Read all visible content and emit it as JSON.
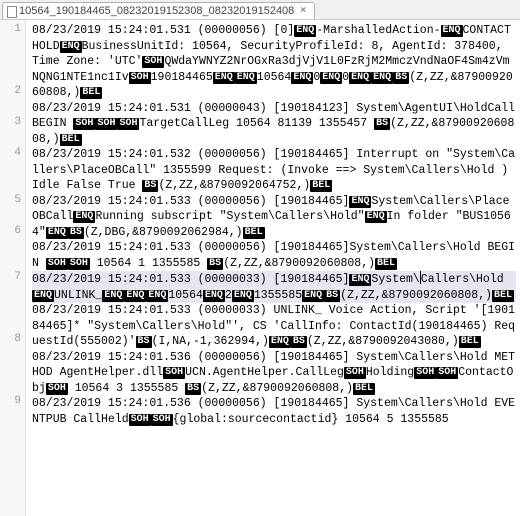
{
  "tab": {
    "title": "10564_190184465_08232019152308_08232019152408",
    "close": "×"
  },
  "gutter": [
    "1",
    "",
    "",
    "",
    "2",
    "",
    "3",
    "",
    "4",
    "",
    "",
    "5",
    "",
    "6",
    "",
    "",
    "7",
    "",
    "",
    "",
    "8",
    "",
    "",
    "",
    "9",
    ""
  ],
  "tokens": {
    "ENQ": "ENQ",
    "SOH": "SOH",
    "BS": "BS",
    "BEL": "BEL"
  },
  "lines": [
    {
      "row": 1,
      "highlight": false,
      "segments": [
        [
          [
            "t",
            "08/23/2019 15:24:01.531 (00000056)"
          ]
        ],
        [
          [
            "t",
            "[0]"
          ],
          [
            "k",
            "ENQ"
          ],
          [
            "t",
            "-MarshalledAction-"
          ],
          [
            "k",
            "ENQ"
          ],
          [
            "t",
            "CONTACTHOLD"
          ],
          [
            "k",
            "ENQ"
          ],
          [
            "t",
            "BusinessUnitId: 10564, SecurityProfileId: 8, AgentId: 378400, Time Zone: 'UTC'"
          ],
          [
            "k",
            "SOH"
          ],
          [
            "t",
            "QWdaYWNYZ2NrOGxRa3djVjV1L0FzRjM2MmczVndNaOF4Sm4zVmNQNG1NTE1nc1Iv"
          ],
          [
            "k",
            "SOH"
          ],
          [
            "t",
            "190184465"
          ],
          [
            "k",
            "ENQ"
          ],
          [
            "k",
            "ENQ"
          ],
          [
            "t",
            "10564"
          ],
          [
            "k",
            "ENQ"
          ],
          [
            "t",
            "0"
          ],
          [
            "k",
            "ENQ"
          ],
          [
            "t",
            "0"
          ],
          [
            "k",
            "ENQ"
          ],
          [
            "k",
            "ENQ"
          ],
          [
            "k",
            "BS"
          ],
          [
            "t",
            "(Z,ZZ,&8790092060808,)"
          ],
          [
            "k",
            "BEL"
          ]
        ]
      ]
    },
    {
      "row": 2,
      "highlight": false,
      "segments": [
        [
          [
            "t",
            "08/23/2019 15:24:01.531 (00000043) [190184123] System\\AgentUI\\HoldCall BEGIN "
          ],
          [
            "k",
            "SOH"
          ],
          [
            "k",
            "SOH"
          ],
          [
            "k",
            "SOH"
          ],
          [
            "t",
            "TargetCallLeg 10564 81139 1355457  "
          ],
          [
            "k",
            "BS"
          ],
          [
            "t",
            "(Z,ZZ,&8790092060808,)"
          ],
          [
            "k",
            "BEL"
          ]
        ]
      ]
    },
    {
      "row": 3,
      "highlight": false,
      "segments": [
        [
          [
            "t",
            "08/23/2019 15:24:01.532 (00000056) [190184465] Interrupt on \"System\\Callers\\PlaceOBCall\" 1355599 Request: (Invoke ==> System\\Callers\\Hold  ) Idle False True "
          ],
          [
            "k",
            "BS"
          ],
          [
            "t",
            "(Z,ZZ,&8790092064752,)"
          ],
          [
            "k",
            "BEL"
          ]
        ]
      ]
    },
    {
      "row": 4,
      "highlight": false,
      "segments": [
        [
          [
            "t",
            "08/23/2019 15:24:01.533 (00000056)"
          ]
        ],
        [
          [
            "t",
            "[190184465]"
          ],
          [
            "k",
            "ENQ"
          ],
          [
            "t",
            "System\\Callers\\PlaceOBCall"
          ],
          [
            "k",
            "ENQ"
          ],
          [
            "t",
            "Running subscript \"System\\Callers\\Hold\""
          ],
          [
            "k",
            "ENQ"
          ],
          [
            "t",
            "In folder \"BUS10564\""
          ],
          [
            "k",
            "ENQ"
          ],
          [
            "k",
            "BS"
          ],
          [
            "t",
            "(Z,DBG,&8790092062984,)"
          ],
          [
            "k",
            "BEL"
          ]
        ]
      ]
    },
    {
      "row": 5,
      "highlight": false,
      "segments": [
        [
          [
            "t",
            "08/23/2019 15:24:01.533 (00000056) [190184465]System\\Callers\\Hold BEGIN "
          ],
          [
            "k",
            "SOH"
          ],
          [
            "k",
            "SOH"
          ],
          [
            "t",
            " 10564 1 1355585  "
          ],
          [
            "k",
            "BS"
          ],
          [
            "t",
            "(Z,ZZ,&8790092060808,)"
          ],
          [
            "k",
            "BEL"
          ]
        ]
      ]
    },
    {
      "row": 6,
      "highlight": true,
      "segments": [
        [
          [
            "t",
            "08/23/2019 15:24:01.533 (00000033)"
          ]
        ],
        [
          [
            "t",
            "[190184465]"
          ],
          [
            "k",
            "ENQ"
          ],
          [
            "t",
            "System\\"
          ],
          [
            "c",
            ""
          ],
          [
            "t",
            "Callers\\Hold"
          ],
          [
            "k",
            "ENQ"
          ],
          [
            "t",
            "UNLINK_"
          ],
          [
            "k",
            "ENQ"
          ],
          [
            "k",
            "ENQ"
          ],
          [
            "k",
            "ENQ"
          ],
          [
            "t",
            "10564"
          ],
          [
            "k",
            "ENQ"
          ],
          [
            "t",
            "2"
          ],
          [
            "k",
            "ENQ"
          ],
          [
            "t",
            "1355585"
          ],
          [
            "k",
            "ENQ"
          ],
          [
            "k",
            "BS"
          ],
          [
            "t",
            "(Z,ZZ,&8790092060808,)"
          ],
          [
            "k",
            "BEL"
          ]
        ]
      ]
    },
    {
      "row": 7,
      "highlight": false,
      "segments": [
        [
          [
            "t",
            "08/23/2019 15:24:01.533 (00000033)  UNLINK_ Voice Action, Script '[190184465]* \"System\\Callers\\Hold\"', CS 'CallInfo: ContactId(190184465) RequestId(555002)'"
          ],
          [
            "k",
            "BS"
          ],
          [
            "t",
            "(I,NA,-1,362994,)"
          ],
          [
            "k",
            "ENQ"
          ],
          [
            "k",
            "BS"
          ],
          [
            "t",
            "(Z,ZZ,&8790092043080,)"
          ],
          [
            "k",
            "BEL"
          ]
        ]
      ]
    },
    {
      "row": 8,
      "highlight": false,
      "segments": [
        [
          [
            "t",
            "08/23/2019 15:24:01.536 (00000056) [190184465] System\\Callers\\Hold METHOD AgentHelper.dll"
          ],
          [
            "k",
            "SOH"
          ],
          [
            "t",
            "UCN.AgentHelper.CallLeg"
          ],
          [
            "k",
            "SOH"
          ],
          [
            "t",
            "Holding"
          ],
          [
            "k",
            "SOH"
          ],
          [
            "k",
            "SOH"
          ],
          [
            "t",
            "ContactObj"
          ],
          [
            "k",
            "SOH"
          ],
          [
            "t",
            " 10564 3 1355585  "
          ],
          [
            "k",
            "BS"
          ],
          [
            "t",
            "(Z,ZZ,&8790092060808,)"
          ],
          [
            "k",
            "BEL"
          ]
        ]
      ]
    },
    {
      "row": 9,
      "highlight": false,
      "segments": [
        [
          [
            "t",
            "08/23/2019 15:24:01.536 (00000056) [190184465] System\\Callers\\Hold EVENTPUB CallHeld"
          ],
          [
            "k",
            "SOH"
          ],
          [
            "k",
            "SOH"
          ],
          [
            "t",
            "{global:sourcecontactid} 10564 5 1355585"
          ]
        ]
      ]
    }
  ]
}
